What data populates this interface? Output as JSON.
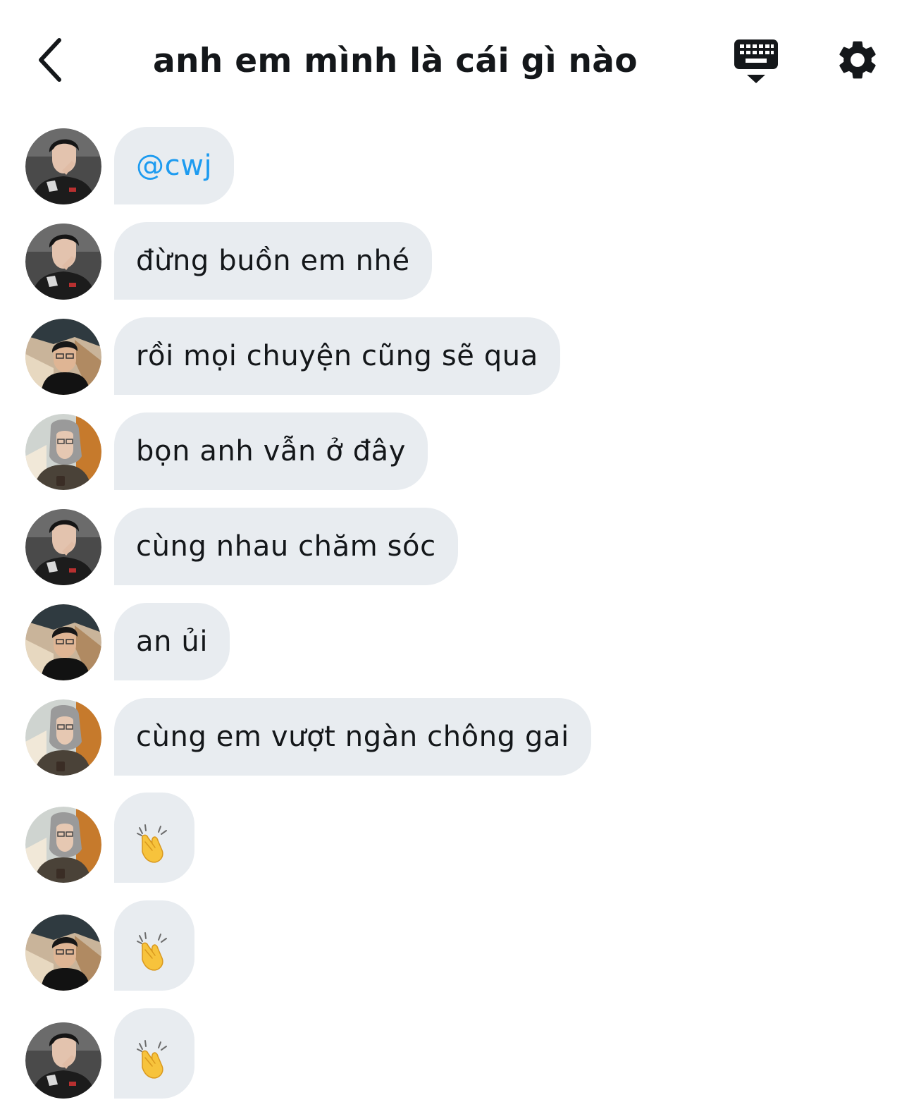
{
  "header": {
    "title": "anh em mình là cái gì nào"
  },
  "messages": [
    {
      "text": "@cwj",
      "avatar": "user-1"
    },
    {
      "text": "đừng buồn em nhé",
      "avatar": "user-1"
    },
    {
      "text": "rồi mọi chuyện cũng sẽ qua",
      "avatar": "user-2"
    },
    {
      "text": "bọn anh vẫn ở đây",
      "avatar": "user-3"
    },
    {
      "text": "cùng nhau chăm sóc",
      "avatar": "user-1"
    },
    {
      "text": "an ủi",
      "avatar": "user-2"
    },
    {
      "text": "cùng em vượt ngàn chông gai",
      "avatar": "user-3"
    },
    {
      "text": "👏",
      "avatar": "user-3",
      "icon": "clapping-hands-emoji"
    },
    {
      "text": "👏",
      "avatar": "user-2",
      "icon": "clapping-hands-emoji"
    },
    {
      "text": "👏",
      "avatar": "user-1",
      "icon": "clapping-hands-emoji"
    }
  ],
  "colors": {
    "bubble": "#e8ecf0",
    "mention": "#1d9bf0",
    "text": "#14171a"
  }
}
